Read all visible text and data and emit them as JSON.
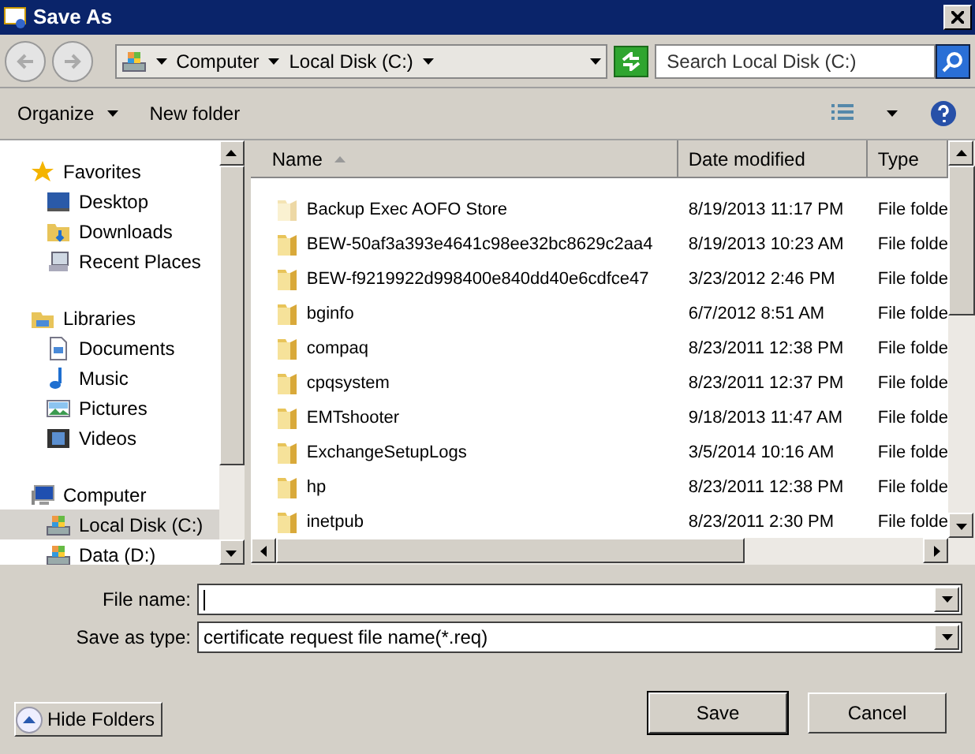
{
  "window": {
    "title": "Save As"
  },
  "address": {
    "crumbs": [
      "Computer",
      "Local Disk (C:)"
    ]
  },
  "search": {
    "placeholder": "Search Local Disk (C:)"
  },
  "toolbar": {
    "buttons": [
      {
        "label": "Organize",
        "kind": "menu"
      },
      {
        "label": "New folder",
        "kind": "plain"
      }
    ]
  },
  "sidebar": {
    "groups": [
      {
        "label": "Favorites",
        "children": [
          {
            "label": "Desktop",
            "selected": false
          },
          {
            "label": "Downloads",
            "selected": false
          },
          {
            "label": "Recent Places",
            "selected": false
          }
        ]
      },
      {
        "label": "Libraries",
        "children": [
          {
            "label": "Documents",
            "selected": false
          },
          {
            "label": "Music",
            "selected": false
          },
          {
            "label": "Pictures",
            "selected": false
          },
          {
            "label": "Videos",
            "selected": false
          }
        ]
      },
      {
        "label": "Computer",
        "children": [
          {
            "label": "Local Disk (C:)",
            "selected": true
          },
          {
            "label": "Data (D:)",
            "selected": false
          }
        ]
      }
    ]
  },
  "table": {
    "columns": [
      "Name",
      "Date modified",
      "Type"
    ],
    "rows": [
      {
        "name": "Backup Exec AOFO Store",
        "date": "8/19/2013 11:17 PM",
        "type": "File folde",
        "hidden": true
      },
      {
        "name": "BEW-50af3a393e4641c98ee32bc8629c2aa4",
        "date": "8/19/2013 10:23 AM",
        "type": "File folde",
        "hidden": false
      },
      {
        "name": "BEW-f9219922d998400e840dd40e6cdfce47",
        "date": "3/23/2012 2:46 PM",
        "type": "File folde",
        "hidden": false
      },
      {
        "name": "bginfo",
        "date": "6/7/2012 8:51 AM",
        "type": "File folde",
        "hidden": false
      },
      {
        "name": "compaq",
        "date": "8/23/2011 12:38 PM",
        "type": "File folde",
        "hidden": false
      },
      {
        "name": "cpqsystem",
        "date": "8/23/2011 12:37 PM",
        "type": "File folde",
        "hidden": false
      },
      {
        "name": "EMTshooter",
        "date": "9/18/2013 11:47 AM",
        "type": "File folde",
        "hidden": false
      },
      {
        "name": "ExchangeSetupLogs",
        "date": "3/5/2014 10:16 AM",
        "type": "File folde",
        "hidden": false
      },
      {
        "name": "hp",
        "date": "8/23/2011 12:38 PM",
        "type": "File folde",
        "hidden": false
      },
      {
        "name": "inetpub",
        "date": "8/23/2011 2:30 PM",
        "type": "File folde",
        "hidden": false
      }
    ]
  },
  "fields": [
    {
      "label": "File name:"
    },
    {
      "label": "Save as type:",
      "value": "certificate request file name(*.req)"
    }
  ],
  "hide_folders": "Hide Folders",
  "buttons": [
    {
      "label": "Save",
      "default": true
    },
    {
      "label": "Cancel",
      "default": false
    }
  ]
}
